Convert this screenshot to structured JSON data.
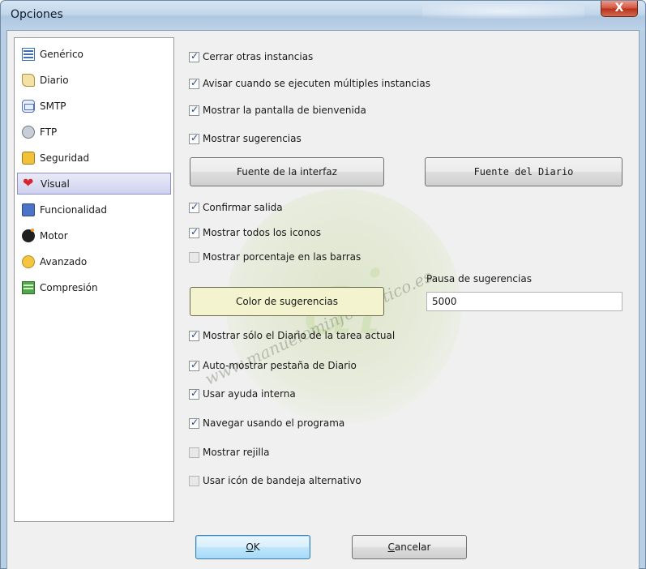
{
  "window": {
    "title": "Opciones",
    "close_glyph": "X"
  },
  "sidebar": {
    "items": [
      {
        "label": "Genérico",
        "icon": "generico-icon",
        "selected": false
      },
      {
        "label": "Diario",
        "icon": "diario-icon",
        "selected": false
      },
      {
        "label": "SMTP",
        "icon": "smtp-icon",
        "selected": false
      },
      {
        "label": "FTP",
        "icon": "ftp-icon",
        "selected": false
      },
      {
        "label": "Seguridad",
        "icon": "seguridad-icon",
        "selected": false
      },
      {
        "label": "Visual",
        "icon": "visual-icon",
        "selected": true
      },
      {
        "label": "Funcionalidad",
        "icon": "funcionalidad-icon",
        "selected": false
      },
      {
        "label": "Motor",
        "icon": "motor-icon",
        "selected": false
      },
      {
        "label": "Avanzado",
        "icon": "avanzado-icon",
        "selected": false
      },
      {
        "label": "Compresión",
        "icon": "compresion-icon",
        "selected": false
      }
    ]
  },
  "options": {
    "cerrar_instancias": {
      "label": "Cerrar otras instancias",
      "checked": true
    },
    "avisar_multiples": {
      "label": "Avisar cuando se ejecuten múltiples instancias",
      "checked": true
    },
    "mostrar_bienvenida": {
      "label": "Mostrar la pantalla de bienvenida",
      "checked": true
    },
    "mostrar_sugerencias": {
      "label": "Mostrar sugerencias",
      "checked": true
    },
    "confirmar_salida": {
      "label": "Confirmar salida",
      "checked": true
    },
    "mostrar_iconos": {
      "label": "Mostrar todos los iconos",
      "checked": true
    },
    "mostrar_porcentaje": {
      "label": "Mostrar porcentaje en las barras",
      "checked": false
    },
    "mostrar_diario_tarea": {
      "label": "Mostrar sólo el Diario de la tarea actual",
      "checked": true
    },
    "auto_mostrar_pestana": {
      "label": "Auto-mostrar pestaña de Diario",
      "checked": true
    },
    "usar_ayuda": {
      "label": "Usar ayuda interna",
      "checked": true
    },
    "navegar_programa": {
      "label": "Navegar usando el programa",
      "checked": true
    },
    "mostrar_rejilla": {
      "label": "Mostrar rejilla",
      "checked": false
    },
    "icono_bandeja": {
      "label": "Usar icón de bandeja  alternativo",
      "checked": false
    }
  },
  "buttons": {
    "fuente_interfaz": "Fuente de la interfaz",
    "fuente_diario": "Fuente del Diario",
    "color_sugerencias": "Color de sugerencias",
    "ok_access": "O",
    "ok_rest": "K",
    "cancelar_access": "C",
    "cancelar_rest": "ancelar"
  },
  "pausa": {
    "label": "Pausa de sugerencias",
    "value": "5000"
  },
  "watermark": {
    "url": "www.manuelominformatico.es",
    "logo": "ai"
  },
  "colors": {
    "selection": "#cfd2ee",
    "color_button": "#f3f4cf",
    "window_frame": "#b9cfe4"
  }
}
